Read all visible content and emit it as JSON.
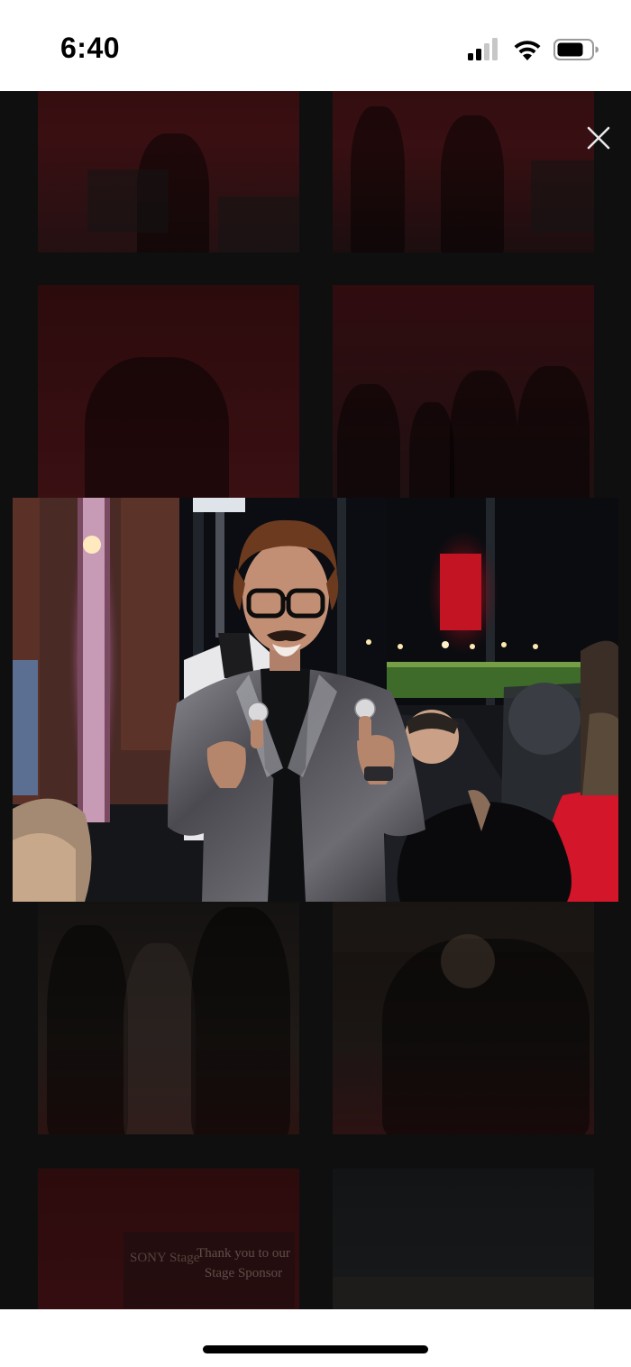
{
  "status_bar": {
    "time": "6:40",
    "icons": [
      "cellular-signal-icon",
      "wifi-icon",
      "battery-icon"
    ]
  },
  "viewer": {
    "close_icon": "close-icon",
    "background_color": "#0f0f0f",
    "thumbnail_sponsor_text": "Thank you to our Stage Sponsor",
    "thumbnail_sponsor_logo": "SONY Stage"
  }
}
